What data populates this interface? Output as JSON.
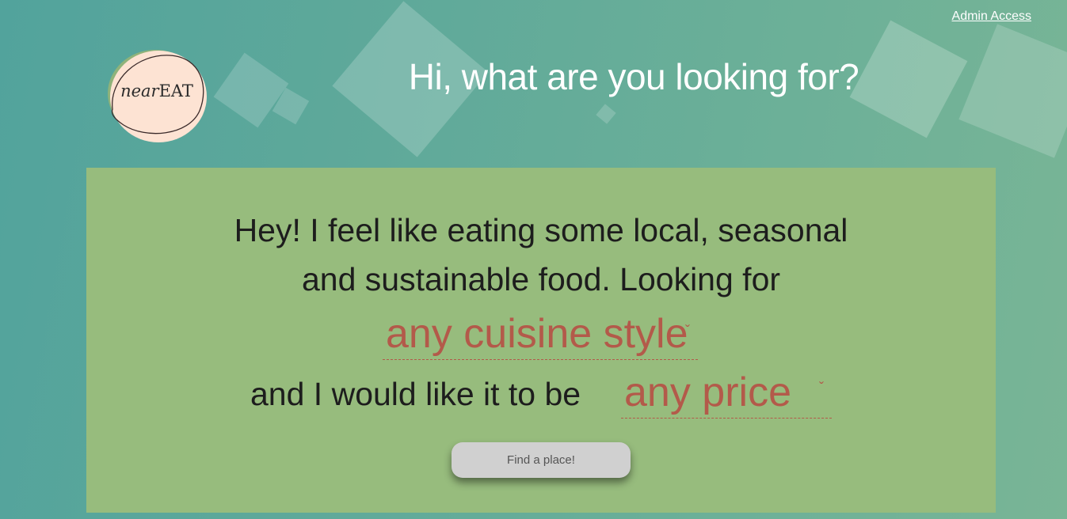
{
  "header": {
    "admin_link": "Admin Access",
    "title": "Hi, what are you looking for?"
  },
  "logo": {
    "near": "near",
    "eat": "EAT"
  },
  "search": {
    "intro_line1": "Hey! I feel like eating some local, seasonal",
    "intro_line2": "and sustainable food. Looking for",
    "cuisine_selected": "any cuisine style",
    "price_prefix": "and I would like it to be",
    "price_selected": "any price",
    "button_label": "Find a place!"
  },
  "colors": {
    "panel": "#97bc7d",
    "accent": "#b35a4a",
    "logo_fill": "#fde3d3",
    "logo_green": "#8fb37a"
  },
  "icons": {
    "select_arrow": "chevron-down-icon"
  }
}
